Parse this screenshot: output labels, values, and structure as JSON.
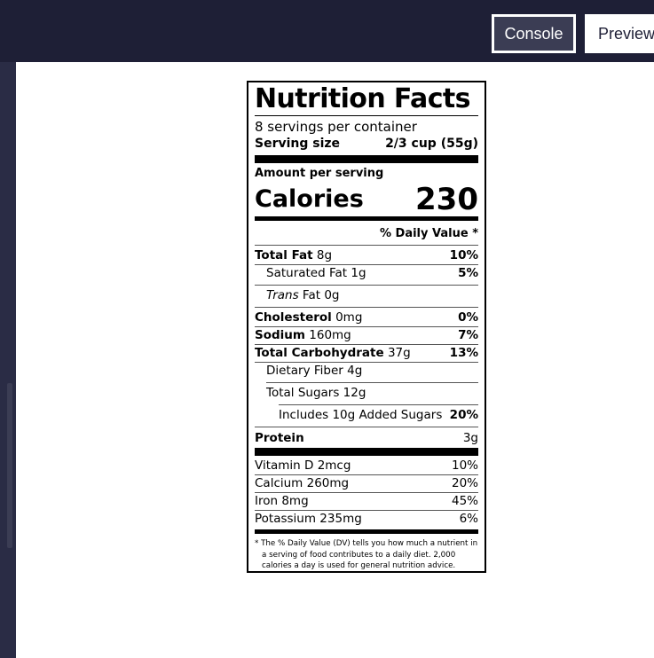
{
  "toolbar": {
    "console_label": "Console",
    "preview_label": "Preview"
  },
  "label": {
    "title": "Nutrition Facts",
    "servings_per_container": "8 servings per container",
    "serving_size_label": "Serving size",
    "serving_size_value": "2/3 cup (55g)",
    "amount_per_serving": "Amount per serving",
    "calories_label": "Calories",
    "calories_value": "230",
    "daily_value_header": "% Daily Value *",
    "nutrients": [
      {
        "name": "Total Fat",
        "amount": "8g",
        "dv": "10%"
      },
      {
        "name": "Saturated Fat",
        "amount": "1g",
        "dv": "5%"
      },
      {
        "name": "Trans",
        "suffix": "Fat",
        "amount": "0g",
        "dv": ""
      },
      {
        "name": "Cholesterol",
        "amount": "0mg",
        "dv": "0%"
      },
      {
        "name": "Sodium",
        "amount": "160mg",
        "dv": "7%"
      },
      {
        "name": "Total Carbohydrate",
        "amount": "37g",
        "dv": "13%"
      },
      {
        "name": "Dietary Fiber",
        "amount": "4g",
        "dv": ""
      },
      {
        "name": "Total Sugars",
        "amount": "12g",
        "dv": ""
      },
      {
        "name": "Includes 10g Added Sugars",
        "amount": "",
        "dv": "20%"
      },
      {
        "name": "Protein",
        "amount": "",
        "dv": "3g"
      }
    ],
    "vitamins": [
      {
        "name": "Vitamin D 2mcg",
        "dv": "10%"
      },
      {
        "name": "Calcium 260mg",
        "dv": "20%"
      },
      {
        "name": "Iron 8mg",
        "dv": "45%"
      },
      {
        "name": "Potassium 235mg",
        "dv": "6%"
      }
    ],
    "footnote": "* The % Daily Value (DV) tells you how much a nutrient in a serving of food contributes to a daily diet. 2,000 calories a day is used for general nutrition advice."
  }
}
